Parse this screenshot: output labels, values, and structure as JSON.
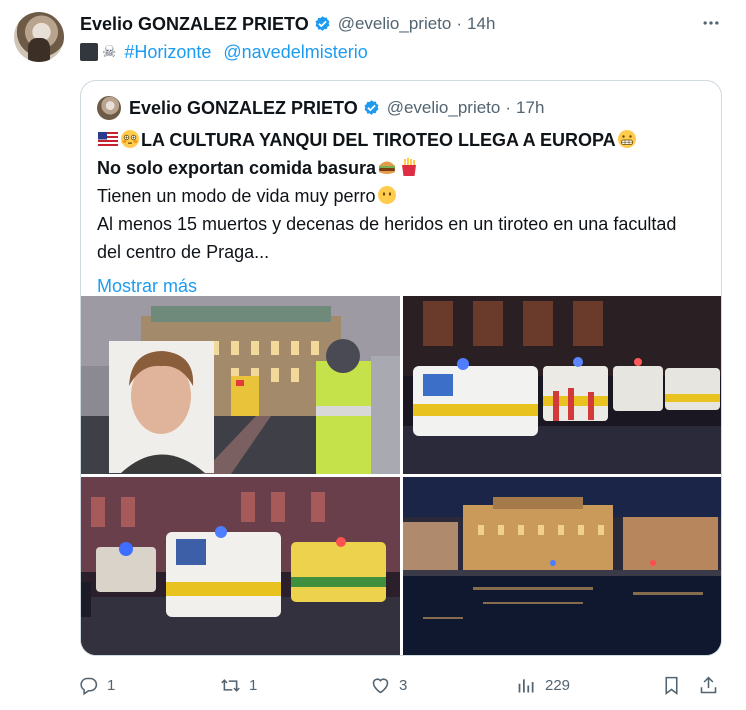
{
  "tweet": {
    "author_name": "Evelio GONZALEZ PRIETO",
    "handle": "@evelio_prieto",
    "separator": "·",
    "time": "14h",
    "hashtag": "#Horizonte",
    "mention": "@navedelmisterio"
  },
  "quoted": {
    "author_name": "Evelio GONZALEZ PRIETO",
    "handle": "@evelio_prieto",
    "separator": "·",
    "time": "17h",
    "line1": "LA CULTURA YANQUI DEL TIROTEO LLEGA A EUROPA",
    "line2": "No solo exportan comida basura",
    "line3": "Tienen un modo de vida muy perro",
    "line4": "Al menos 15 muertos y decenas de heridos en un tiroteo en una facultad",
    "line5": "del centro de Praga...",
    "show_more": "Mostrar más"
  },
  "actions": {
    "replies": "1",
    "reposts": "1",
    "likes": "3",
    "views": "229"
  },
  "icons": [
    "verified-badge-icon",
    "more-icon",
    "reply-icon",
    "repost-icon",
    "like-icon",
    "views-icon",
    "bookmark-icon",
    "share-icon"
  ],
  "colors": {
    "accent": "#1d9bf0",
    "secondary_text": "#536471",
    "border": "#cfd9de"
  }
}
